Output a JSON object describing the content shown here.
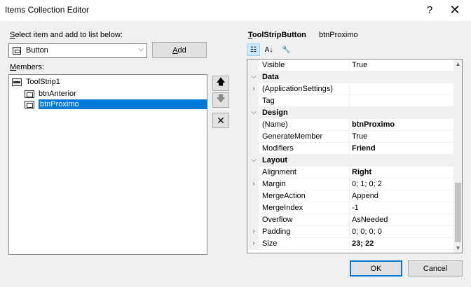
{
  "window": {
    "title": "Items Collection Editor",
    "help_glyph": "?",
    "close_glyph": "✕"
  },
  "left": {
    "select_label_u": "S",
    "select_label_rest": "elect item and add to list below:",
    "combo_value": "Button",
    "add_u": "A",
    "add_rest": "dd",
    "members_u": "M",
    "members_rest": "embers:",
    "tree": [
      {
        "label": "ToolStrip1"
      },
      {
        "label": "btnAnterior"
      },
      {
        "label": "btnProximo"
      }
    ]
  },
  "side_buttons": {
    "up": "🡅",
    "down": "🡇",
    "delete": "✕"
  },
  "right": {
    "type_u": "T",
    "type_rest": "oolStripButton",
    "object_name": "btnProximo",
    "rows": [
      {
        "name": "Visible",
        "value": "True"
      },
      {
        "name": "Data"
      },
      {
        "name": "(ApplicationSettings)",
        "value": ""
      },
      {
        "name": "Tag",
        "value": ""
      },
      {
        "name": "Design"
      },
      {
        "name": "(Name)",
        "value": "btnProximo"
      },
      {
        "name": "GenerateMember",
        "value": "True"
      },
      {
        "name": "Modifiers",
        "value": "Friend"
      },
      {
        "name": "Layout"
      },
      {
        "name": "Alignment",
        "value": "Right"
      },
      {
        "name": "Margin",
        "value": "0; 1; 0; 2"
      },
      {
        "name": "MergeAction",
        "value": "Append"
      },
      {
        "name": "MergeIndex",
        "value": "-1"
      },
      {
        "name": "Overflow",
        "value": "AsNeeded"
      },
      {
        "name": "Padding",
        "value": "0; 0; 0; 0"
      },
      {
        "name": "Size",
        "value": "23; 22"
      }
    ]
  },
  "footer": {
    "ok": "OK",
    "cancel": "Cancel"
  },
  "colors": {
    "accent": "#0078d7",
    "selection": "#0078d7"
  }
}
